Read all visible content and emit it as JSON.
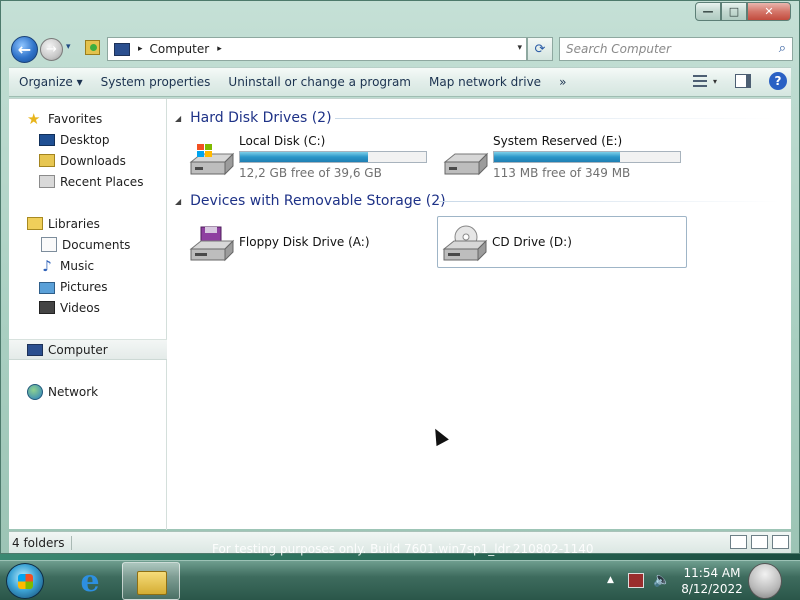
{
  "window": {
    "caption_buttons": {
      "minimize": "—",
      "maximize": "□",
      "close": "✕"
    }
  },
  "nav": {
    "back_glyph": "←",
    "forward_glyph": "→",
    "history_glyph": "▾",
    "address": {
      "separator": "▸",
      "location": "Computer",
      "after_separator": "▸",
      "dropdown_glyph": "▾"
    },
    "refresh_glyph": "⟳",
    "search": {
      "placeholder": "Search Computer",
      "icon_glyph": "⌕"
    }
  },
  "toolbar": {
    "items": [
      "Organize ▾",
      "System properties",
      "Uninstall or change a program",
      "Map network drive",
      "»"
    ],
    "views_caret": "▾",
    "help_glyph": "?"
  },
  "navpane": {
    "favorites": {
      "label": "Favorites",
      "children": [
        "Desktop",
        "Downloads",
        "Recent Places"
      ]
    },
    "libraries": {
      "label": "Libraries",
      "children": [
        "Documents",
        "Music",
        "Pictures",
        "Videos"
      ]
    },
    "computer": {
      "label": "Computer"
    },
    "network": {
      "label": "Network"
    }
  },
  "groups": {
    "hard_disks": {
      "title": "Hard Disk Drives (2)",
      "drives": [
        {
          "name": "Local Disk (C:)",
          "free_text": "12,2 GB free of 39,6 GB",
          "used_fraction": 0.69
        },
        {
          "name": "System Reserved (E:)",
          "free_text": "113 MB free of 349 MB",
          "used_fraction": 0.68
        }
      ]
    },
    "removable": {
      "title": "Devices with Removable Storage (2)",
      "devices": [
        {
          "name": "Floppy Disk Drive (A:)"
        },
        {
          "name": "CD Drive (D:)"
        }
      ]
    }
  },
  "status": {
    "text": "4 folders"
  },
  "watermark": "For testing purposes only. Build 7601.win7sp1_ldr.210802-1140",
  "taskbar": {
    "ie_glyph": "e",
    "tray_arrow": "▲",
    "volume_glyph": "🔈",
    "time": "11:54 AM",
    "date": "8/12/2022"
  },
  "colors": {
    "accent": "#1e3287",
    "progress": "#2b96c8",
    "desktop": "#2a6b58"
  }
}
